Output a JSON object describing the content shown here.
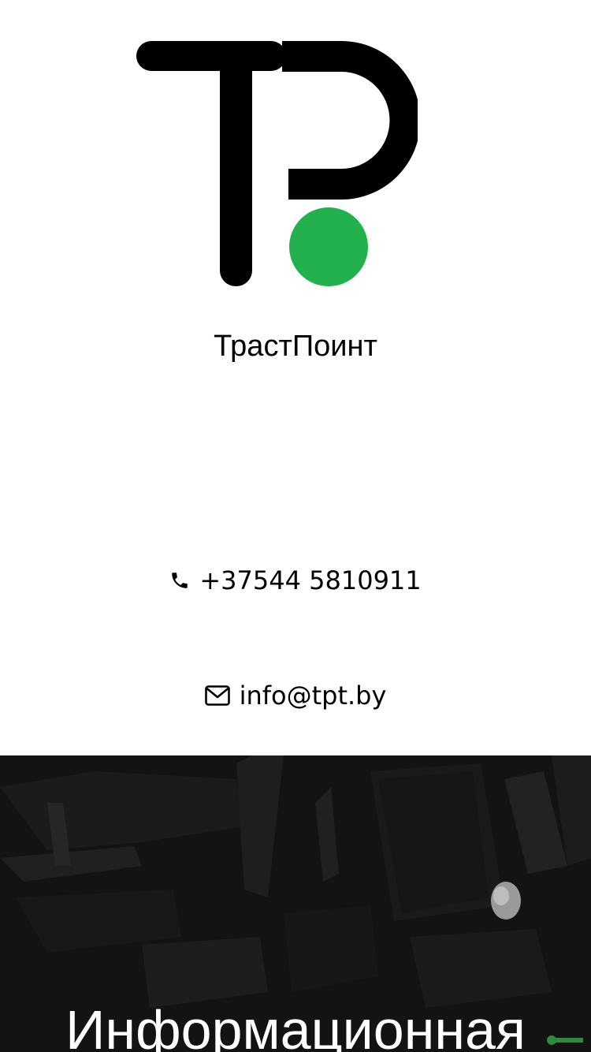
{
  "colors": {
    "logo_black": "#000000",
    "logo_green": "#22b14c",
    "hero_background": "#131313",
    "hero_text": "#ffffff"
  },
  "header": {
    "logo_icon": "tp-logo-icon",
    "brand_name": "ТрастПоинт"
  },
  "contacts": {
    "phone_icon": "phone-icon",
    "phone": "+37544 5810911",
    "email_icon": "envelope-icon",
    "email": "info@tpt.by"
  },
  "hero": {
    "title": "Информационная"
  }
}
